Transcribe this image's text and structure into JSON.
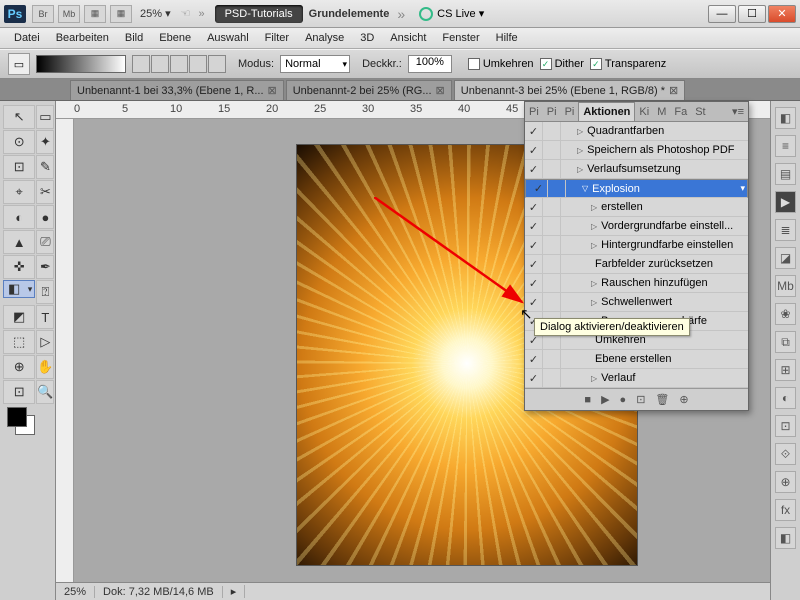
{
  "titlebar": {
    "ps": "Ps",
    "btns": [
      "Br",
      "Mb",
      "▦",
      "▦"
    ],
    "zoom": "25% ▾",
    "pill": "PSD-Tutorials",
    "doc": "Grundelemente",
    "cs": "CS Live ▾",
    "win": {
      "min": "—",
      "max": "☐",
      "close": "✕"
    }
  },
  "menu": [
    "Datei",
    "Bearbeiten",
    "Bild",
    "Ebene",
    "Auswahl",
    "Filter",
    "Analyse",
    "3D",
    "Ansicht",
    "Fenster",
    "Hilfe"
  ],
  "opt": {
    "modus_label": "Modus:",
    "modus_value": "Normal",
    "deck_label": "Deckkr.:",
    "deck_value": "100%",
    "umkehren": "Umkehren",
    "dither": "Dither",
    "transparenz": "Transparenz"
  },
  "tabs": [
    {
      "label": "Unbenannt-1 bei 33,3% (Ebene 1, R...",
      "active": false
    },
    {
      "label": "Unbenannt-2 bei 25% (RG...",
      "active": false
    },
    {
      "label": "Unbenannt-3 bei 25% (Ebene 1, RGB/8) *",
      "active": true
    }
  ],
  "ruler_marks": [
    0,
    5,
    10,
    15,
    20,
    25,
    30,
    35,
    40,
    45
  ],
  "tools": [
    "↖",
    "▭",
    "⊙",
    "✦",
    "⊡",
    "✎",
    "⌖",
    "✂",
    "◐",
    "●",
    "▲",
    "⎚",
    "✜",
    "✒",
    "◧",
    "⍰",
    "◩",
    "T",
    "⬚",
    "▷",
    "⊕",
    "✋",
    "⊡",
    "🔍"
  ],
  "rightrail": [
    "◧",
    "≡",
    "▤",
    "▶",
    "≣",
    "◪",
    "Mb",
    "❀",
    "⧉",
    "⊞",
    "◐",
    "⊡",
    "⟐",
    "⊕",
    "fx",
    "◧"
  ],
  "panel": {
    "tabs": [
      "Pi",
      "Pi",
      "Pi",
      "Aktionen",
      "Ki",
      "M",
      "Fa",
      "St"
    ],
    "active_tab": "Aktionen",
    "rows": [
      {
        "check": true,
        "label": "Quadrantfarben",
        "tri": "▷",
        "indent": 0
      },
      {
        "check": true,
        "label": "Speichern als Photoshop PDF",
        "tri": "▷",
        "indent": 0
      },
      {
        "check": true,
        "label": "Verlaufsumsetzung",
        "tri": "▷",
        "indent": 0
      },
      {
        "check": true,
        "label": "Explosion",
        "tri": "▽",
        "indent": 0,
        "sel": true
      },
      {
        "check": true,
        "label": "erstellen",
        "tri": "▷",
        "indent": 1
      },
      {
        "check": true,
        "label": "Vordergrundfarbe einstell...",
        "tri": "▷",
        "indent": 1
      },
      {
        "check": true,
        "label": "Hintergrundfarbe einstellen",
        "tri": "▷",
        "indent": 1
      },
      {
        "check": true,
        "label": "Farbfelder zurücksetzen",
        "tri": "",
        "indent": 1
      },
      {
        "check": true,
        "label": "Rauschen hinzufügen",
        "tri": "▷",
        "indent": 1
      },
      {
        "check": true,
        "label": "Schwellenwert",
        "tri": "▷",
        "indent": 1
      },
      {
        "check": true,
        "label": "Bewegungsunschärfe",
        "tri": "▷",
        "indent": 1
      },
      {
        "check": true,
        "label": "Umkehren",
        "tri": "",
        "indent": 1
      },
      {
        "check": true,
        "label": "Ebene erstellen",
        "tri": "",
        "indent": 1
      },
      {
        "check": true,
        "label": "Verlauf",
        "tri": "▷",
        "indent": 1
      }
    ],
    "footer": [
      "■",
      "▶",
      "●",
      "⊡",
      "🗑",
      "⊕"
    ]
  },
  "tooltip": "Dialog aktivieren/deaktivieren",
  "status": {
    "zoom": "25%",
    "dok": "Dok: 7,32 MB/14,6 MB"
  }
}
